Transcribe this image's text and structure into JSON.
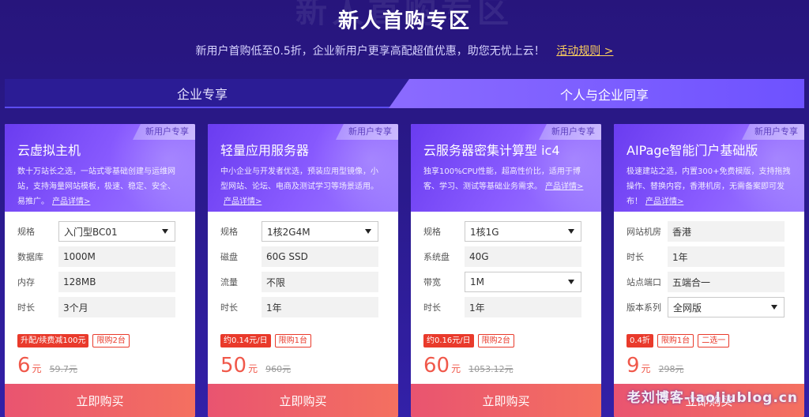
{
  "header": {
    "title": "新人首购专区",
    "subtitle": "新用户首购低至0.5折，企业新用户更享高配超值优惠，助您无忧上云！",
    "rules_link": "活动规则 >"
  },
  "tabs": [
    {
      "label": "企业专享",
      "active": false
    },
    {
      "label": "个人与企业同享",
      "active": true
    }
  ],
  "cards": [
    {
      "badge": "新用户专享",
      "title": "云虚拟主机",
      "desc": "数十万站长之选，一站式零基础创建与运维网站，支持海量网站模板，极速、稳定、安全、易推广。",
      "detail_link": "产品详情>",
      "rows": [
        {
          "label": "规格",
          "value": "入门型BC01",
          "select": true
        },
        {
          "label": "数据库",
          "value": "1000M",
          "select": false
        },
        {
          "label": "内存",
          "value": "128MB",
          "select": false
        },
        {
          "label": "时长",
          "value": "3个月",
          "select": false
        }
      ],
      "tags": [
        {
          "text": "升配/续费减100元",
          "style": "fill"
        },
        {
          "text": "限购2台",
          "style": "line"
        }
      ],
      "price": "6",
      "unit": "元",
      "old_price": "59.7元",
      "buy": "立即购买"
    },
    {
      "badge": "新用户专享",
      "title": "轻量应用服务器",
      "desc": "中小企业与开发者优选，预装应用型镜像，小型网站、论坛、电商及测试学习等场景适用。",
      "detail_link": "产品详情>",
      "rows": [
        {
          "label": "规格",
          "value": "1核2G4M",
          "select": true
        },
        {
          "label": "磁盘",
          "value": "60G SSD",
          "select": false
        },
        {
          "label": "流量",
          "value": "不限",
          "select": false
        },
        {
          "label": "时长",
          "value": "1年",
          "select": false
        }
      ],
      "tags": [
        {
          "text": "约0.14元/日",
          "style": "fill"
        },
        {
          "text": "限购1台",
          "style": "line"
        }
      ],
      "price": "50",
      "unit": "元",
      "old_price": "960元",
      "buy": "立即购买"
    },
    {
      "badge": "新用户专享",
      "title": "云服务器密集计算型 ic4",
      "desc": "独享100%CPU性能，超高性价比，适用于博客、学习、测试等基础业务需求。",
      "detail_link": "产品详情>",
      "rows": [
        {
          "label": "规格",
          "value": "1核1G",
          "select": true
        },
        {
          "label": "系统盘",
          "value": "40G",
          "select": false
        },
        {
          "label": "带宽",
          "value": "1M",
          "select": true
        },
        {
          "label": "时长",
          "value": "1年",
          "select": false
        }
      ],
      "tags": [
        {
          "text": "约0.16元/日",
          "style": "fill"
        },
        {
          "text": "限购2台",
          "style": "line"
        }
      ],
      "price": "60",
      "unit": "元",
      "old_price": "1053.12元",
      "buy": "立即购买"
    },
    {
      "badge": "新用户专享",
      "title": "AIPage智能门户基础版",
      "desc": "极速建站之选，内置300+免费模版，支持拖拽操作、替换内容，香港机房，无需备案即可发布！",
      "detail_link": "产品详情>",
      "rows": [
        {
          "label": "网站机房",
          "value": "香港",
          "select": false
        },
        {
          "label": "时长",
          "value": "1年",
          "select": false
        },
        {
          "label": "站点端口",
          "value": "五端合一",
          "select": false
        },
        {
          "label": "版本系列",
          "value": "全网版",
          "select": true
        }
      ],
      "tags": [
        {
          "text": "0.4折",
          "style": "fill"
        },
        {
          "text": "限购1台",
          "style": "line"
        },
        {
          "text": "二选一",
          "style": "line"
        }
      ],
      "price": "9",
      "unit": "元",
      "old_price": "298元",
      "buy": "立即购买"
    }
  ],
  "watermark": "老刘博客-laoliublog.cn"
}
